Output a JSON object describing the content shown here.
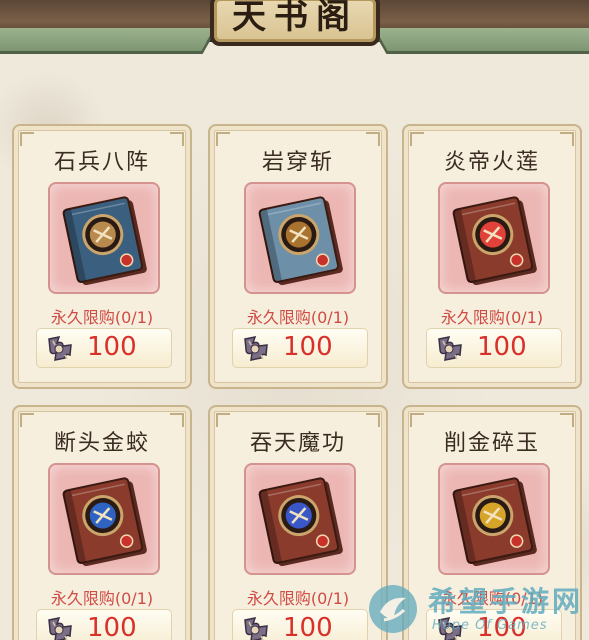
{
  "header": {
    "title": "天书阁"
  },
  "items": [
    {
      "name": "石兵八阵",
      "limit": "永久限购(0/1)",
      "price": "100",
      "cover": "#3b5f7e",
      "emblem": "#b98a4e"
    },
    {
      "name": "岩穿斩",
      "limit": "永久限购(0/1)",
      "price": "100",
      "cover": "#6d8fa8",
      "emblem": "#a9722f"
    },
    {
      "name": "炎帝火莲",
      "limit": "永久限购(0/1)",
      "price": "100",
      "cover": "#8a3b2c",
      "emblem": "#e0423a"
    },
    {
      "name": "断头金蛟",
      "limit": "永久限购(0/1)",
      "price": "100",
      "cover": "#8a3b2c",
      "emblem": "#2f63c2"
    },
    {
      "name": "吞天魔功",
      "limit": "永久限购(0/1)",
      "price": "100",
      "cover": "#8a3b2c",
      "emblem": "#3a57c8"
    },
    {
      "name": "削金碎玉",
      "limit": "永久限购(0/1)",
      "price": "100",
      "cover": "#8a3b2c",
      "emblem": "#d7a42a"
    }
  ],
  "watermark": {
    "title": "希望手游网",
    "subtitle": "Hope Of Games"
  },
  "icons": {
    "currency": "puzzle-fragment-icon",
    "book": "skill-book-icon"
  }
}
